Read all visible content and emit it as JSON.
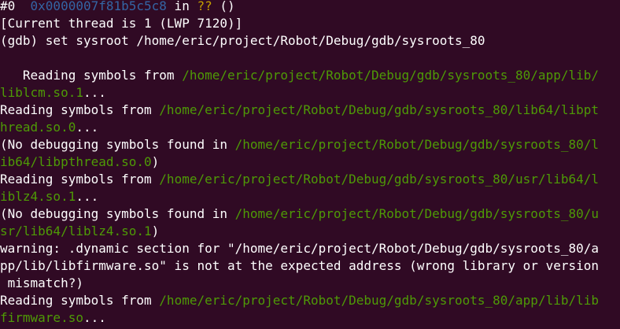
{
  "colors": {
    "background": "#300a24",
    "text": "#ffffff",
    "path": "#4e9a06",
    "address": "#3465a4",
    "unknown": "#c4a000"
  },
  "terminal": {
    "lines": [
      [
        {
          "t": "#0  ",
          "k": "plain"
        },
        {
          "t": "0x0000007f81b5c5c8",
          "k": "addr"
        },
        {
          "t": " in ",
          "k": "plain"
        },
        {
          "t": "??",
          "k": "unknown"
        },
        {
          "t": " ()",
          "k": "plain"
        }
      ],
      [
        {
          "t": "[Current thread is 1 (LWP 7120)]",
          "k": "plain"
        }
      ],
      [
        {
          "t": "(gdb) set sysroot /home/eric/project/Robot/Debug/gdb/sysroots_80",
          "k": "plain"
        }
      ],
      [],
      [
        {
          "t": "   Reading symbols from ",
          "k": "plain"
        },
        {
          "t": "/home/eric/project/Robot/Debug/gdb/sysroots_80/app/lib/",
          "k": "path"
        }
      ],
      [
        {
          "t": "liblcm.so.1",
          "k": "path"
        },
        {
          "t": "...",
          "k": "plain"
        }
      ],
      [
        {
          "t": "Reading symbols from ",
          "k": "plain"
        },
        {
          "t": "/home/eric/project/Robot/Debug/gdb/sysroots_80/lib64/libpt",
          "k": "path"
        }
      ],
      [
        {
          "t": "hread.so.0",
          "k": "path"
        },
        {
          "t": "...",
          "k": "plain"
        }
      ],
      [
        {
          "t": "(No debugging symbols found in ",
          "k": "plain"
        },
        {
          "t": "/home/eric/project/Robot/Debug/gdb/sysroots_80/l",
          "k": "path"
        }
      ],
      [
        {
          "t": "ib64/libpthread.so.0",
          "k": "path"
        },
        {
          "t": ")",
          "k": "plain"
        }
      ],
      [
        {
          "t": "Reading symbols from ",
          "k": "plain"
        },
        {
          "t": "/home/eric/project/Robot/Debug/gdb/sysroots_80/usr/lib64/l",
          "k": "path"
        }
      ],
      [
        {
          "t": "iblz4.so.1",
          "k": "path"
        },
        {
          "t": "...",
          "k": "plain"
        }
      ],
      [
        {
          "t": "(No debugging symbols found in ",
          "k": "plain"
        },
        {
          "t": "/home/eric/project/Robot/Debug/gdb/sysroots_80/u",
          "k": "path"
        }
      ],
      [
        {
          "t": "sr/lib64/liblz4.so.1",
          "k": "path"
        },
        {
          "t": ")",
          "k": "plain"
        }
      ],
      [
        {
          "t": "warning: .dynamic section for \"/home/eric/project/Robot/Debug/gdb/sysroots_80/a",
          "k": "plain"
        }
      ],
      [
        {
          "t": "pp/lib/libfirmware.so\" is not at the expected address (wrong library or version",
          "k": "plain"
        }
      ],
      [
        {
          "t": " mismatch?)",
          "k": "plain"
        }
      ],
      [
        {
          "t": "Reading symbols from ",
          "k": "plain"
        },
        {
          "t": "/home/eric/project/Robot/Debug/gdb/sysroots_80/app/lib/lib",
          "k": "path"
        }
      ],
      [
        {
          "t": "firmware.so",
          "k": "path"
        },
        {
          "t": "...",
          "k": "plain"
        }
      ]
    ]
  }
}
